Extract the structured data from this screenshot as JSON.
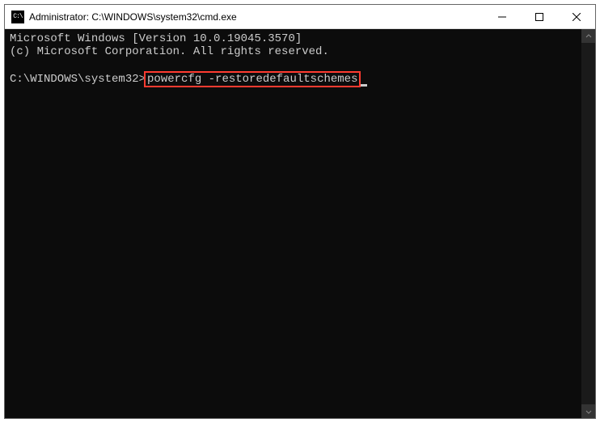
{
  "window": {
    "title": "Administrator: C:\\WINDOWS\\system32\\cmd.exe",
    "icon_label": "cmd-icon"
  },
  "titlebar_controls": {
    "minimize": "Minimize",
    "maximize": "Maximize",
    "close": "Close"
  },
  "console": {
    "line1": "Microsoft Windows [Version 10.0.19045.3570]",
    "line2": "(c) Microsoft Corporation. All rights reserved.",
    "prompt": "C:\\WINDOWS\\system32>",
    "command": "powercfg -restoredefaultschemes"
  },
  "highlight": {
    "color": "#ff3b30"
  }
}
